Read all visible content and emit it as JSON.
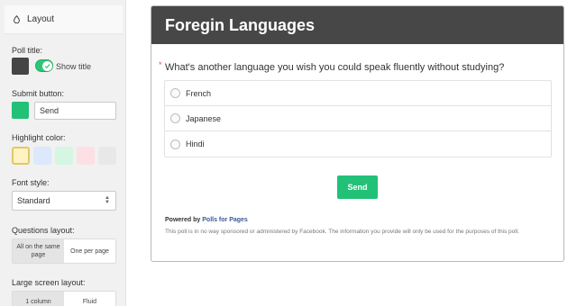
{
  "sidebar": {
    "header": {
      "title": "Layout",
      "icon": "droplet-icon"
    },
    "poll_title": {
      "label": "Poll title:",
      "color": "#454545",
      "toggle_on": true,
      "toggle_label": "Show title"
    },
    "submit_button": {
      "label": "Submit button:",
      "color": "#22c177",
      "value": "Send"
    },
    "highlight": {
      "label": "Highlight color:",
      "swatches": [
        "#fff3c4",
        "#dce8fb",
        "#d4f6e3",
        "#fde0e6",
        "#e8e8e8"
      ],
      "selected_index": 0
    },
    "font_style": {
      "label": "Font style:",
      "value": "Standard"
    },
    "questions_layout": {
      "label": "Questions layout:",
      "options": [
        "All on the same page",
        "One per page"
      ],
      "active_index": 0
    },
    "large_screen_layout": {
      "label": "Large screen layout:",
      "options": [
        "1 column",
        "Fluid"
      ],
      "active_index": 0
    }
  },
  "poll": {
    "title": "Foregin Languages",
    "header_color": "#474747",
    "question": {
      "required_mark": "*",
      "text": "What's another language you wish you could speak fluently without studying?",
      "options": [
        "French",
        "Japanese",
        "Hindi"
      ]
    },
    "send_label": "Send",
    "footer": {
      "powered_by": "Powered by",
      "link_text": "Polls for Pages",
      "disclaimer": "This poll is in no way sponsored or administered by Facebook. The information you provide will only be used for the purposes of this poll."
    }
  }
}
